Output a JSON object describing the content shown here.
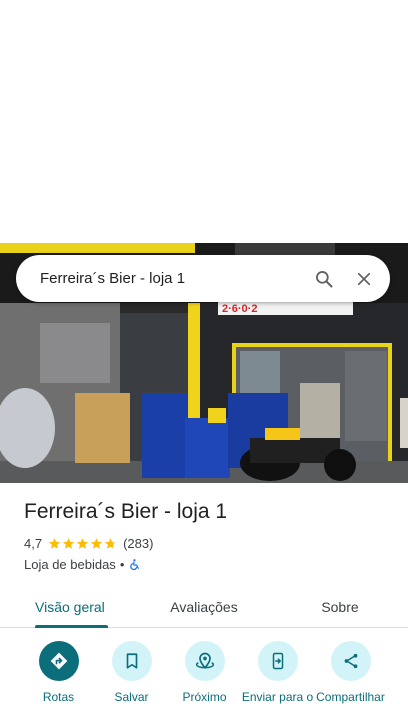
{
  "search": {
    "query": "Ferreira´s Bier - loja 1"
  },
  "place": {
    "name": "Ferreira´s Bier - loja 1",
    "rating": "4,7",
    "rating_value": 4.7,
    "review_count": "(283)",
    "category": "Loja de bebidas",
    "separator": "•",
    "accessibility_icon": "wheelchair-icon"
  },
  "photo": {
    "storefront_sign": "2·6·0·2"
  },
  "tabs": [
    {
      "label": "Visão geral",
      "active": true
    },
    {
      "label": "Avaliações",
      "active": false
    },
    {
      "label": "Sobre",
      "active": false
    }
  ],
  "actions": [
    {
      "label": "Rotas",
      "icon": "directions-icon"
    },
    {
      "label": "Salvar",
      "icon": "bookmark-icon"
    },
    {
      "label": "Próximo",
      "icon": "nearby-icon"
    },
    {
      "label": "Enviar para o",
      "icon": "send-to-phone-icon"
    },
    {
      "label": "Compartilhar",
      "icon": "share-icon"
    }
  ],
  "colors": {
    "accent": "#0b6e7a",
    "action_bg": "#d2f3f8",
    "star": "#fbbc04"
  }
}
